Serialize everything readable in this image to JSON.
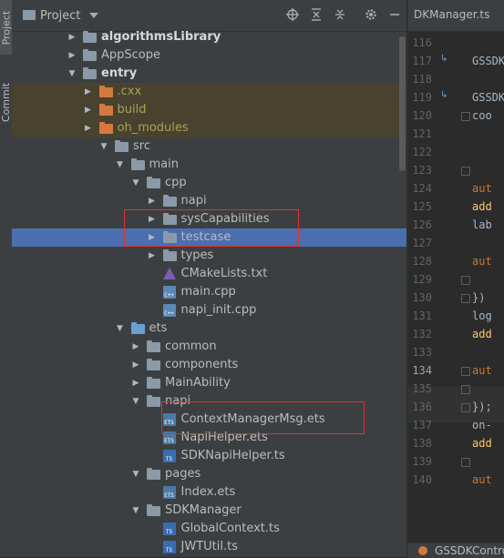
{
  "sidebar_tabs": {
    "project": "Project",
    "commit": "Commit"
  },
  "panel": {
    "title": "Project"
  },
  "tree": [
    {
      "label": "algorithmsLibrary",
      "arrow": "right",
      "type": "folder",
      "bold": true
    },
    {
      "label": "AppScope",
      "arrow": "right",
      "type": "folder"
    },
    {
      "label": "entry",
      "arrow": "down",
      "type": "folder",
      "bold": true
    },
    {
      "label": ".cxx",
      "arrow": "right",
      "type": "folder-orange",
      "olive": true
    },
    {
      "label": "build",
      "arrow": "right",
      "type": "folder-orange",
      "olive": true
    },
    {
      "label": "oh_modules",
      "arrow": "right",
      "type": "folder-orange",
      "olive": true
    },
    {
      "label": "src",
      "arrow": "down",
      "type": "folder"
    },
    {
      "label": "main",
      "arrow": "down",
      "type": "folder"
    },
    {
      "label": "cpp",
      "arrow": "down",
      "type": "folder"
    },
    {
      "label": "napi",
      "arrow": "right",
      "type": "folder"
    },
    {
      "label": "sysCapabilities",
      "arrow": "right",
      "type": "folder"
    },
    {
      "label": "testcase",
      "arrow": "right",
      "type": "folder",
      "selected": true
    },
    {
      "label": "types",
      "arrow": "right",
      "type": "folder"
    },
    {
      "label": "CMakeLists.txt",
      "type": "cmake"
    },
    {
      "label": "main.cpp",
      "type": "cpp",
      "icon_text": "C++"
    },
    {
      "label": "napi_init.cpp",
      "type": "cpp",
      "icon_text": "C++"
    },
    {
      "label": "ets",
      "arrow": "down",
      "type": "folder-blue"
    },
    {
      "label": "common",
      "arrow": "right",
      "type": "folder"
    },
    {
      "label": "components",
      "arrow": "right",
      "type": "folder"
    },
    {
      "label": "MainAbility",
      "arrow": "right",
      "type": "folder"
    },
    {
      "label": "napi",
      "arrow": "down",
      "type": "folder"
    },
    {
      "label": "ContextManagerMsg.ets",
      "type": "ets",
      "icon_text": "ETS"
    },
    {
      "label": "NapiHelper.ets",
      "type": "ets",
      "icon_text": "ETS"
    },
    {
      "label": "SDKNapiHelper.ts",
      "type": "ts",
      "icon_text": "TS"
    },
    {
      "label": "pages",
      "arrow": "down",
      "type": "folder"
    },
    {
      "label": "Index.ets",
      "type": "ets",
      "icon_text": "ETS"
    },
    {
      "label": "SDKManager",
      "arrow": "down",
      "type": "folder"
    },
    {
      "label": "GlobalContext.ts",
      "type": "ts",
      "icon_text": "TS"
    },
    {
      "label": "JWTUtil.ts",
      "type": "ts",
      "icon_text": "TS"
    }
  ],
  "editor": {
    "tab_label": "DKManager.ts",
    "bottom_tab_label": "GSSDKContro",
    "line_numbers": [
      "116",
      "117",
      "118",
      "119",
      "120",
      "121",
      "122",
      "123",
      "124",
      "125",
      "126",
      "127",
      "128",
      "129",
      "130",
      "131",
      "132",
      "133",
      "134",
      "135",
      "136",
      "137",
      "138",
      "139",
      "140"
    ],
    "code_lines": {
      "117": "GSSDK",
      "119": "GSSDK",
      "120": "coo",
      "124": "aut",
      "125": "add",
      "126": "lab",
      "128": "aut",
      "130": "})",
      "131": "log",
      "132": "add",
      "134": "aut",
      "136": "});",
      "137": "on-",
      "138": "add",
      "140": "aut"
    }
  },
  "colors": {
    "selection": "#4b6eaf",
    "excluded_row": "#49422f",
    "highlight_box": "#e03030"
  }
}
